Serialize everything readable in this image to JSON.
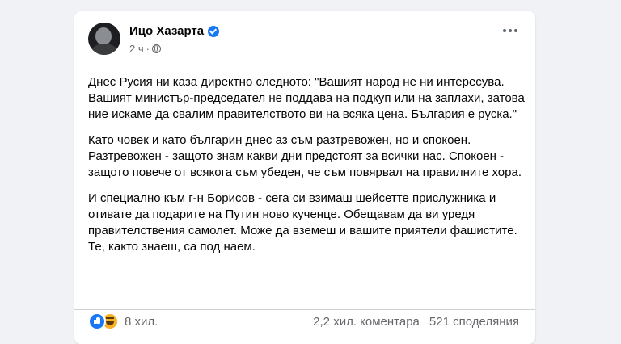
{
  "post": {
    "author": "Ицо Хазарта",
    "time": "2 ч",
    "meta_separator": "·",
    "paragraphs": [
      "Днес Русия ни каза директно следното: \"Вашият народ не ни интересува. Вашият министър-председател не поддава на подкуп или на заплахи, затова ние искаме да свалим правителството ви на всяка цена. България е руска.\"",
      "Като човек и като българин днес аз съм разтревожен, но и спокоен. Разтревожен - защото знам какви дни предстоят за всички нас. Спокоен - защото повече от всякога съм убеден, че съм повярвал на правилните хора.",
      "И специално към г-н Борисов - сега си взимаш шейсетте прислужника и отивате да подарите на Путин ново кученце. Обещавам да ви уредя правителствения самолет. Може да вземеш и вашите приятели фашистите. Те, както знаеш, са под наем."
    ],
    "reactions_count": "8 хил.",
    "comments_count": "2,2 хил. коментара",
    "shares_count": "521 споделяния",
    "reaction_icons": [
      "like-icon",
      "haha-icon"
    ],
    "colors": {
      "accent": "#1877f2",
      "haha": "#f7b125",
      "muted": "#65676b"
    }
  }
}
